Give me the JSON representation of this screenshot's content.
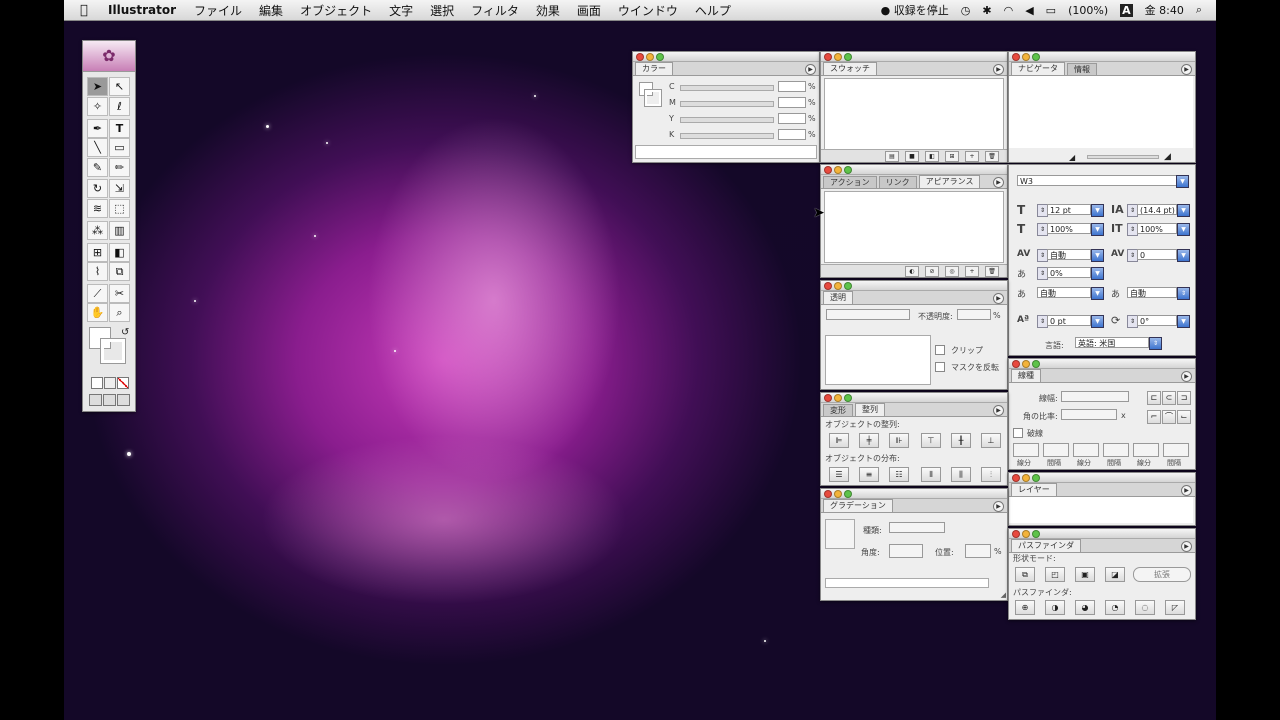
{
  "menubar": {
    "app": "Illustrator",
    "items": [
      "ファイル",
      "編集",
      "オブジェクト",
      "文字",
      "選択",
      "フィルタ",
      "効果",
      "画面",
      "ウインドウ",
      "ヘルプ"
    ],
    "recording": "● 収録を停止",
    "battery": "(100%)",
    "input": "A",
    "clock": "金 8:40"
  },
  "color_panel": {
    "tab": "カラー",
    "channels": [
      "C",
      "M",
      "Y",
      "K"
    ],
    "unit": "%"
  },
  "swatch_panel": {
    "tab": "スウォッチ"
  },
  "navigator_panel": {
    "tabs": [
      "ナビゲータ",
      "情報"
    ]
  },
  "action_panel": {
    "tabs": [
      "アクション",
      "リンク",
      "アピアランス"
    ]
  },
  "transparency_panel": {
    "tab": "透明",
    "opacity_label": "不透明度:",
    "unit": "%",
    "clip": "クリップ",
    "invert_mask": "マスクを反転"
  },
  "character_panel": {
    "font": "W3",
    "size": "12 pt",
    "leading": "(14.4 pt)",
    "vscale": "100%",
    "hscale": "100%",
    "kerning": "自動",
    "tracking": "0",
    "tsume": "0%",
    "aki_left": "自動",
    "aki_right": "自動",
    "baseline": "0 pt",
    "rotation": "0°",
    "language_label": "言語:",
    "language": "英語: 米国"
  },
  "align_panel": {
    "tabs": [
      "変形",
      "整列"
    ],
    "align_label": "オブジェクトの整列:",
    "distribute_label": "オブジェクトの分布:"
  },
  "stroke_panel": {
    "tab": "線種",
    "weight_label": "線幅:",
    "miter_label": "角の比率:",
    "x": "x",
    "dashed": "破線",
    "dash_labels": [
      "線分",
      "間隔",
      "線分",
      "間隔",
      "線分",
      "間隔"
    ]
  },
  "gradient_panel": {
    "tab": "グラデーション",
    "type_label": "種類:",
    "angle_label": "角度:",
    "location_label": "位置:",
    "unit": "%"
  },
  "layer_panel": {
    "tab": "レイヤー"
  },
  "pathfinder_panel": {
    "tab": "パスファインダ",
    "shape_mode": "形状モード:",
    "expand": "拡張",
    "pathfinder_label": "パスファインダ:"
  }
}
